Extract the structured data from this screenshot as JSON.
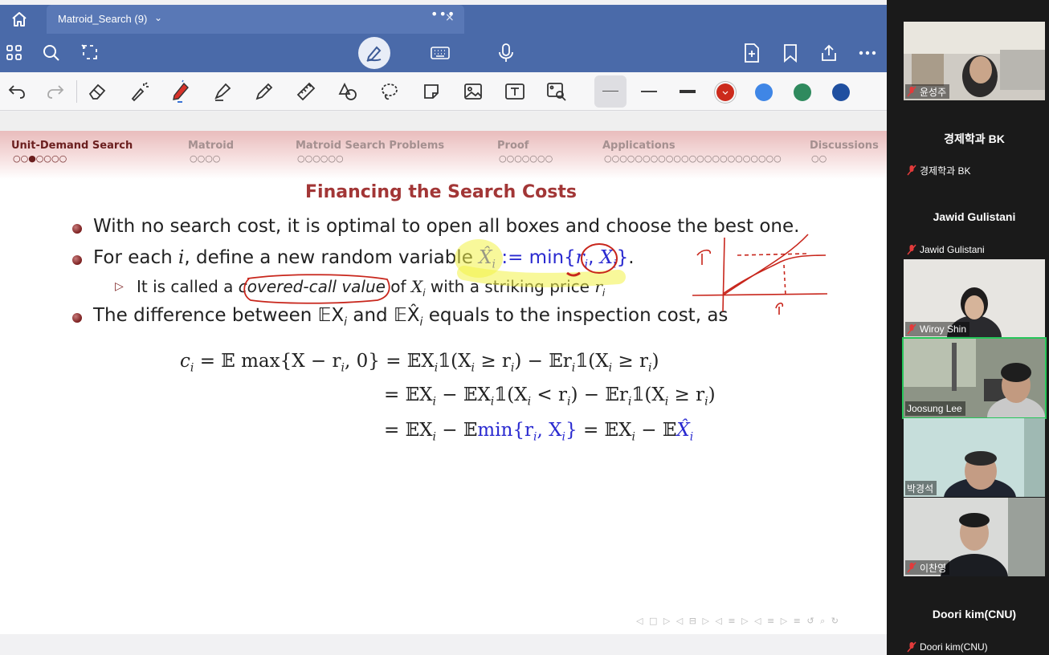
{
  "tab": {
    "title": "Matroid_Search (9)",
    "more": "•••",
    "close": "×",
    "chevron": "⌄"
  },
  "toolbar_top": {
    "icons": [
      "home-icon",
      "grid-icon",
      "search-icon",
      "lasso-select-icon",
      "pen-mode-icon",
      "keyboard-icon",
      "microphone-icon",
      "add-page-icon",
      "bookmark-icon",
      "share-icon",
      "more-icon"
    ]
  },
  "toolbar_tools": {
    "icons": [
      "undo-icon",
      "redo-icon",
      "eraser-icon",
      "laser-pointer-icon",
      "pen-icon",
      "highlighter-icon",
      "pencil-icon",
      "ruler-icon",
      "shapes-icon",
      "lasso-icon",
      "sticker-icon",
      "image-icon",
      "text-box-icon",
      "image-search-icon"
    ],
    "colors": [
      "#cc2a1c",
      "#3f86e6",
      "#2f8a5e",
      "#1f4fa0"
    ]
  },
  "slide": {
    "nav": [
      {
        "label": "Unit-Demand Search",
        "dots": "○○●○○○○"
      },
      {
        "label": "Matroid",
        "dots": "○○○○"
      },
      {
        "label": "Matroid Search Problems",
        "dots": "○○○○○○"
      },
      {
        "label": "Proof",
        "dots": "○○○○○○○"
      },
      {
        "label": "Applications",
        "dots": "○○○○○○○○○○○○○○○○○○○○○○○"
      },
      {
        "label": "Discussions",
        "dots": "○○"
      }
    ],
    "title": "Financing the Search Costs",
    "bullet1": "With no search cost, it is optimal to open all boxes and choose the best one.",
    "bullet2_pre": "For each ",
    "bullet2_i": "i",
    "bullet2_mid": ", define a new random variable ",
    "bullet2_xhat": "X̂",
    "bullet2_sub": "i",
    "bullet2_def": " := min{",
    "bullet2_r": "r",
    "bullet2_comma": ", ",
    "bullet2_x": "X",
    "bullet2_close": "}",
    "bullet2_end": ".",
    "sub_pre": "It is called a ",
    "sub_em": "covered-call value",
    "sub_mid": " of ",
    "sub_x": "X",
    "sub_post": " with a striking price ",
    "sub_r": "r",
    "bullet3": "The difference between 𝔼X",
    "bullet3_a": " and 𝔼X̂",
    "bullet3_b": " equals to the inspection cost, as",
    "eq1": "= 𝔼 max{X − r",
    "eq1b": ", 0} = 𝔼X",
    "eq1c": "𝟙(X",
    "eq1d": " ≥ r",
    "eq1e": ") − 𝔼r",
    "eq1f": "𝟙(X",
    "eq1g": " ≥ r",
    "eq1h": ")",
    "eq2": "= 𝔼X",
    "eq2b": " − 𝔼X",
    "eq2c": "𝟙(X",
    "eq2d": " < r",
    "eq2e": ") − 𝔼r",
    "eq2f": "𝟙(X",
    "eq2g": " ≥ r",
    "eq2h": ")",
    "eq3": "= 𝔼X",
    "eq3b": " − 𝔼",
    "eq3min": "min{r",
    "eq3min2": ", X",
    "eq3min3": "}",
    "eq3c": " = 𝔼X",
    "eq3d": " − 𝔼",
    "eq3xhat": "X̂",
    "c": "c",
    "sub_i": "i",
    "nav_glyphs": "◁ □ ▷ ◁ ⊟ ▷ ◁ ≡ ▷ ◁ ≡ ▷   ≡   ↺ ⌕ ↻"
  },
  "participants": [
    {
      "name": "윤성주",
      "type": "video"
    },
    {
      "name": "경제학과 BK",
      "label": "경제학과 BK",
      "type": "name"
    },
    {
      "name": "Jawid Gulistani",
      "label": "Jawid Gulistani",
      "type": "name"
    },
    {
      "name": "Wiroy Shin",
      "type": "video"
    },
    {
      "name": "Joosung Lee",
      "type": "video",
      "active": true
    },
    {
      "name": "박경석",
      "type": "video"
    },
    {
      "name": "이찬영",
      "type": "video"
    },
    {
      "name": "Doori kim(CNU)",
      "label": "Doori kim(CNU)",
      "type": "name"
    }
  ]
}
